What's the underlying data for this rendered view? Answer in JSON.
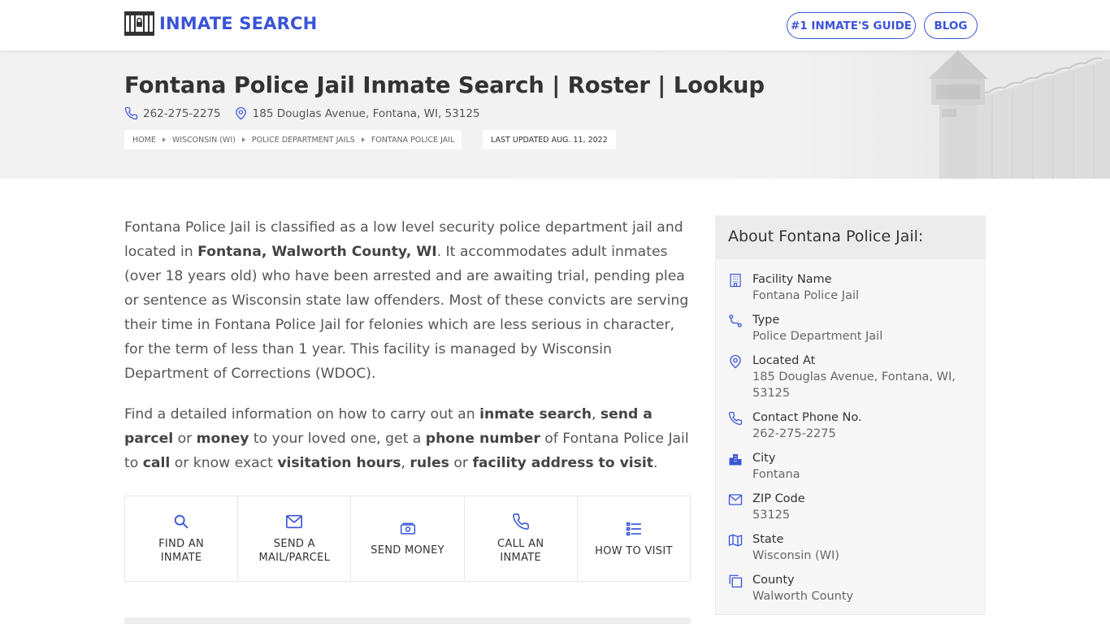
{
  "header": {
    "logo_text": "INMATE SEARCH",
    "nav": [
      {
        "label": "#1 INMATE'S GUIDE"
      },
      {
        "label": "BLOG"
      }
    ]
  },
  "hero": {
    "title": "Fontana Police Jail Inmate Search | Roster | Lookup",
    "phone": "262-275-2275",
    "address": "185 Douglas Avenue, Fontana, WI, 53125",
    "breadcrumb": [
      "HOME",
      "WISCONSIN (WI)",
      "POLICE DEPARTMENT JAILS",
      "FONTANA POLICE JAIL"
    ],
    "last_updated": "LAST UPDATED AUG. 11, 2022"
  },
  "intro": {
    "p1_a": "Fontana Police Jail is classified as a low level security police department jail and located in ",
    "p1_b": "Fontana, Walworth County, WI",
    "p1_c": ". It accommodates adult inmates (over 18 years old) who have been arrested and are awaiting trial, pending plea or sentence as Wisconsin state law offenders. Most of these convicts are serving their time in Fontana Police Jail for felonies which are less serious in character, for the term of less than 1 year. This facility is managed by Wisconsin Department of Corrections (WDOC).",
    "p2": [
      {
        "t": "Find a detailed information on how to carry out an ",
        "b": false
      },
      {
        "t": "inmate search",
        "b": true
      },
      {
        "t": ", ",
        "b": false
      },
      {
        "t": "send a parcel",
        "b": true
      },
      {
        "t": " or ",
        "b": false
      },
      {
        "t": "money",
        "b": true
      },
      {
        "t": " to your loved one, get a ",
        "b": false
      },
      {
        "t": "phone number",
        "b": true
      },
      {
        "t": " of Fontana Police Jail to ",
        "b": false
      },
      {
        "t": "call",
        "b": true
      },
      {
        "t": " or know exact ",
        "b": false
      },
      {
        "t": "visitation hours",
        "b": true
      },
      {
        "t": ", ",
        "b": false
      },
      {
        "t": "rules",
        "b": true
      },
      {
        "t": " or ",
        "b": false
      },
      {
        "t": "facility address to visit",
        "b": true
      },
      {
        "t": ".",
        "b": false
      }
    ]
  },
  "actions": [
    {
      "label": "FIND AN INMATE",
      "icon": "search-icon"
    },
    {
      "label": "SEND A MAIL/PARCEL",
      "icon": "mail-icon"
    },
    {
      "label": "SEND MONEY",
      "icon": "money-icon"
    },
    {
      "label": "CALL AN INMATE",
      "icon": "phone-icon"
    },
    {
      "label": "HOW TO VISIT",
      "icon": "list-icon"
    }
  ],
  "about": {
    "heading": "About Fontana Police Jail:",
    "items": [
      {
        "key": "Facility Name",
        "value": "Fontana Police Jail",
        "icon": "building-icon"
      },
      {
        "key": "Type",
        "value": "Police Department Jail",
        "icon": "route-icon"
      },
      {
        "key": "Located At",
        "value": "185 Douglas Avenue, Fontana, WI, 53125",
        "icon": "map-pin-icon"
      },
      {
        "key": "Contact Phone No.",
        "value": "262-275-2275",
        "icon": "phone-icon"
      },
      {
        "key": "City",
        "value": "Fontana",
        "icon": "city-icon"
      },
      {
        "key": "ZIP Code",
        "value": "53125",
        "icon": "mail-icon"
      },
      {
        "key": "State",
        "value": "Wisconsin (WI)",
        "icon": "map-icon"
      },
      {
        "key": "County",
        "value": "Walworth County",
        "icon": "copy-icon"
      }
    ]
  },
  "colors": {
    "accent": "#3a54d6",
    "text": "#555555",
    "heading": "#333333",
    "panel": "#f7f7f7"
  }
}
